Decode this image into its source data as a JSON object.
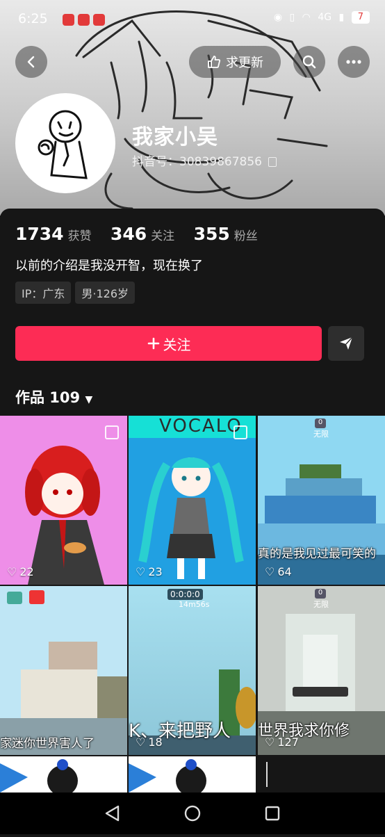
{
  "status_bar": {
    "time": "6:25",
    "right_indicators": "4G",
    "battery": "7"
  },
  "header": {
    "back_icon": "chevron-left-icon",
    "request_update_label": "求更新",
    "search_icon": "search-icon",
    "more_icon": "more-icon"
  },
  "profile": {
    "username": "我家小吴",
    "douyin_id": "抖音号：30839867856",
    "likes_count": "1734",
    "likes_label": "获赞",
    "following_count": "346",
    "following_label": "关注",
    "followers_count": "355",
    "followers_label": "粉丝",
    "bio": "以前的介绍是我没开智，现在换了",
    "tags": [
      "IP：广东",
      "男·126岁"
    ],
    "follow_button": "关注",
    "share_icon": "send-icon"
  },
  "works": {
    "tab_label": "作品 109",
    "items": [
      {
        "likes": "22",
        "banner": ""
      },
      {
        "likes": "23",
        "banner": "VOCALO"
      },
      {
        "likes": "64",
        "banner": "真的是我见过最可笑的"
      },
      {
        "likes": "",
        "banner": "家迷你世界害人了"
      },
      {
        "likes": "18",
        "banner": "K、来把野人"
      },
      {
        "likes": "127",
        "banner": "世界我求你修"
      }
    ],
    "game_timer": "0:0:0:0",
    "game_timer_sub": "14m56s",
    "game_label": "无限",
    "game_counter": "0"
  },
  "colors": {
    "accent": "#fd2c55",
    "background": "#161616"
  }
}
